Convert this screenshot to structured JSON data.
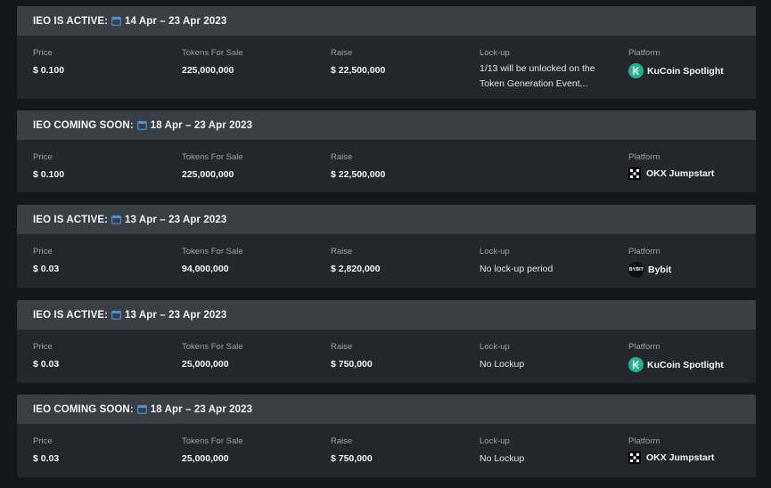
{
  "labels": {
    "price": "Price",
    "tokens": "Tokens For Sale",
    "raise": "Raise",
    "lockup": "Lock-up",
    "platform": "Platform"
  },
  "cards": [
    {
      "status": "IEO IS ACTIVE:",
      "dates": "14 Apr – 23 Apr 2023",
      "price": "$ 0.100",
      "tokens": "225,000,000",
      "raise": "$ 22,500,000",
      "lockup_line1": "1/13 will be unlocked on the",
      "lockup_line2": "Token Generation Event...",
      "platform": "KuCoin Spotlight",
      "platform_icon": "kucoin-logo-icon"
    },
    {
      "status": "IEO COMING SOON:",
      "dates": "18 Apr – 23 Apr 2023",
      "price": "$ 0.100",
      "tokens": "225,000,000",
      "raise": "$ 22,500,000",
      "platform": "OKX Jumpstart",
      "platform_icon": "okx-logo-icon"
    },
    {
      "status": "IEO IS ACTIVE:",
      "dates": "13 Apr – 23 Apr 2023",
      "price": "$ 0.03",
      "tokens": "94,000,000",
      "raise": "$ 2,820,000",
      "lockup": "No lock-up period",
      "platform": "Bybit",
      "platform_icon": "bybit-logo-icon",
      "bybit_logo_text": "BYBIT"
    },
    {
      "status": "IEO IS ACTIVE:",
      "dates": "13 Apr – 23 Apr 2023",
      "price": "$ 0.03",
      "tokens": "25,000,000",
      "raise": "$ 750,000",
      "lockup": "No Lockup",
      "platform": "KuCoin Spotlight",
      "platform_icon": "kucoin-logo-icon"
    },
    {
      "status": "IEO COMING SOON:",
      "dates": "18 Apr – 23 Apr 2023",
      "price": "$ 0.03",
      "tokens": "25,000,000",
      "raise": "$ 750,000",
      "lockup": "No Lockup",
      "platform": "OKX Jumpstart",
      "platform_icon": "okx-logo-icon"
    }
  ],
  "colors": {
    "page_bg": "#14171b",
    "card_bg": "#23272c",
    "header_bg": "#3a3f45",
    "calendar_accent": "#4f8fd8",
    "kucoin_green": "#23af91"
  }
}
